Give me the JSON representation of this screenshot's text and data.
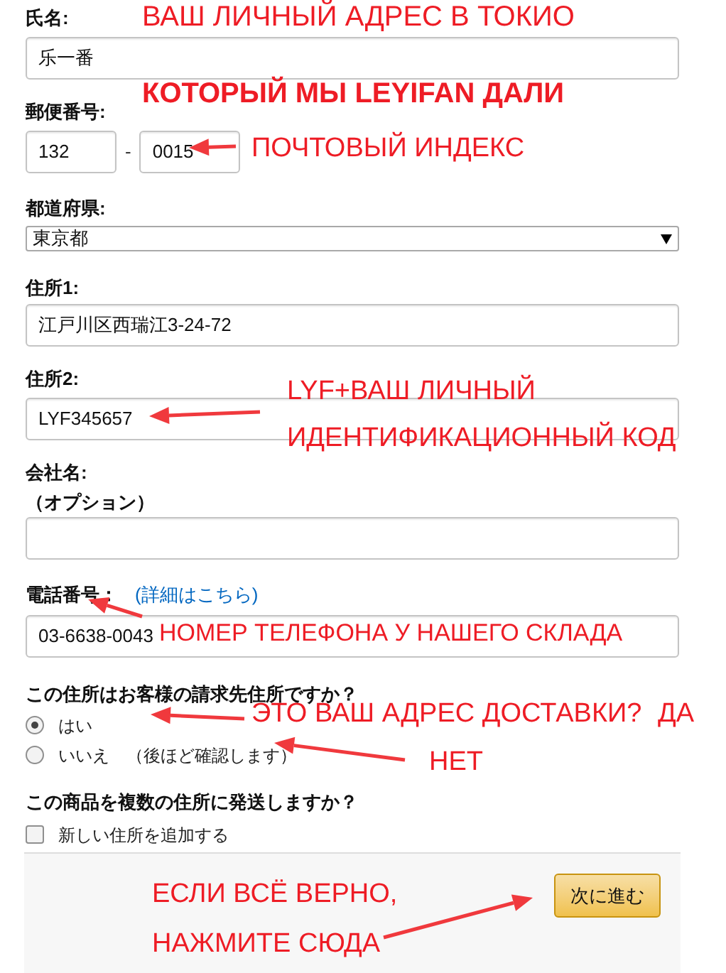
{
  "form": {
    "name": {
      "label": "氏名:",
      "value": "乐一番"
    },
    "postal_code": {
      "label": "郵便番号:",
      "part_1": "132",
      "separator": "-",
      "part_2": "0015"
    },
    "prefecture": {
      "label": "都道府県:",
      "value": "東京都"
    },
    "address_1": {
      "label": "住所1:",
      "value": "江戸川区西瑞江3-24-72"
    },
    "address_2": {
      "label": "住所2:",
      "value": "LYF345657"
    },
    "company": {
      "label": "会社名:",
      "note": "（オプション）"
    },
    "phone": {
      "label": "電話番号：",
      "link": "(詳細はこちら)",
      "value": "03-6638-0043"
    },
    "billing": {
      "question": "この住所はお客様の請求先住所ですか？",
      "options": [
        {
          "label": "はい",
          "selected": true
        },
        {
          "label": "いいえ　（後ほど確認します）",
          "selected": false
        }
      ]
    },
    "multiple": {
      "question": "この商品を複数の住所に発送しますか？",
      "checkbox": {
        "label": "新しい住所を追加する",
        "checked": false
      }
    },
    "next_button": "次に進む"
  },
  "annotations": [
    {
      "text": "ВАШ ЛИЧНЫЙ АДРЕС В ТОКИО",
      "bold": false
    },
    {
      "text": "КОТОРЫЙ МЫ LEYIFAN ДАЛИ",
      "bold": true
    },
    {
      "text": "ПОЧТОВЫЙ ИНДЕКС",
      "bold": false
    },
    {
      "text": "LYF+ВАШ ЛИЧНЫЙ",
      "bold": false
    },
    {
      "text": "ИДЕНТИФИКАЦИОННЫЙ КОД",
      "bold": false
    },
    {
      "text": "НОМЕР ТЕЛЕФОНА У НАШЕГО СКЛАДА",
      "bold": false
    },
    {
      "text": "ЭТО ВАШ АДРЕС ДОСТАВКИ?",
      "bold": false
    },
    {
      "text": "ДА",
      "bold": false
    },
    {
      "text": "НЕТ",
      "bold": false
    },
    {
      "text": "ЕСЛИ ВСЁ ВЕРНО,",
      "bold": false
    },
    {
      "text": "НАЖМИТЕ СЮДА",
      "bold": false
    }
  ]
}
